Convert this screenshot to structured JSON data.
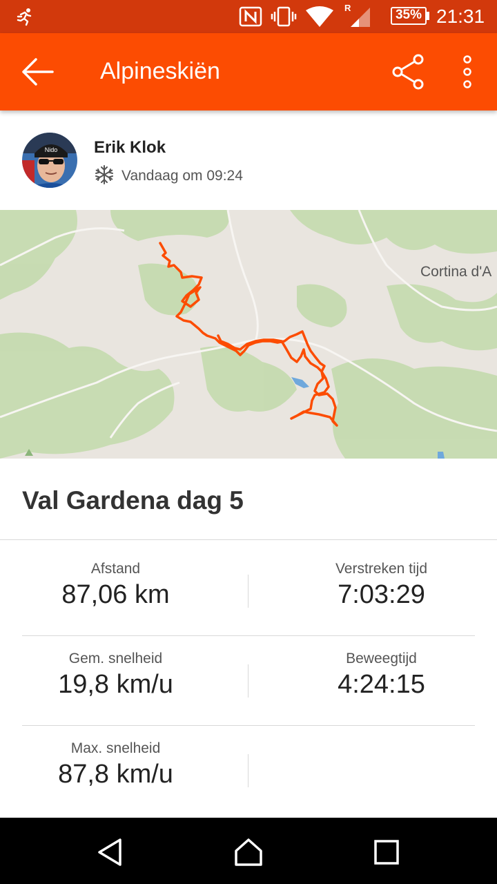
{
  "status_bar": {
    "time": "21:31",
    "battery": "35%",
    "roaming": "R",
    "icons": [
      "strava-runner-icon",
      "nfc-icon",
      "vibrate-icon",
      "wifi-icon",
      "signal-icon",
      "battery-icon"
    ]
  },
  "app_bar": {
    "title": "Alpineskiën",
    "icons": [
      "back-arrow-icon",
      "share-icon",
      "more-vert-icon"
    ]
  },
  "athlete": {
    "name": "Erik Klok",
    "time": "Vandaag om 09:24",
    "activity_icon": "snowflake-icon"
  },
  "map": {
    "place_label": "Cortina d'A",
    "route_color": "#fc4c02"
  },
  "activity": {
    "title": "Val Gardena dag 5"
  },
  "stats": [
    {
      "left": {
        "label": "Afstand",
        "value": "87,06 km"
      },
      "right": {
        "label": "Verstreken tijd",
        "value": "7:03:29"
      }
    },
    {
      "left": {
        "label": "Gem. snelheid",
        "value": "19,8 km/u"
      },
      "right": {
        "label": "Beweegtijd",
        "value": "4:24:15"
      }
    },
    {
      "left": {
        "label": "Max. snelheid",
        "value": "87,8 km/u"
      },
      "right": {
        "label": "",
        "value": ""
      }
    }
  ],
  "nav_bar": {
    "icons": [
      "back-triangle-icon",
      "home-icon",
      "recents-icon"
    ]
  },
  "colors": {
    "brand": "#fc4c02",
    "status_bar": "#d2390c"
  }
}
